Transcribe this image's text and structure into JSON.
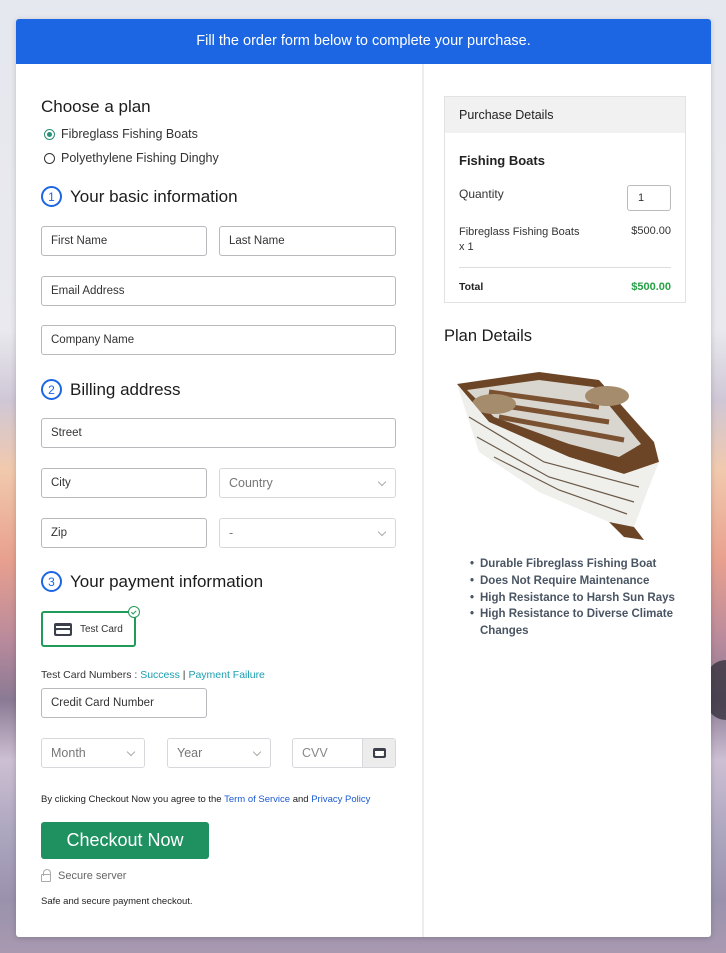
{
  "banner": {
    "text": "Fill the order form below to complete your purchase."
  },
  "plan": {
    "heading": "Choose a plan",
    "options": [
      {
        "label": "Fibreglass Fishing Boats",
        "selected": true
      },
      {
        "label": "Polyethylene Fishing Dinghy",
        "selected": false
      }
    ]
  },
  "basic_info": {
    "number": "1",
    "heading": "Your basic information",
    "first_name": "First Name",
    "last_name": "Last Name",
    "email": "Email Address",
    "company": "Company Name"
  },
  "billing": {
    "number": "2",
    "heading": "Billing address",
    "street": "Street",
    "city": "City",
    "country": "Country",
    "zip": "Zip",
    "state": "-"
  },
  "payment": {
    "number": "3",
    "heading": "Your payment information",
    "method_label": "Test Card",
    "test_numbers_label": "Test Card Numbers : ",
    "success_link": "Success",
    "separator": " | ",
    "failure_link": "Payment Failure",
    "card_number": "Credit Card Number",
    "month": "Month",
    "year": "Year",
    "cvv": "CVV"
  },
  "agreement": {
    "prefix": "By clicking Checkout Now you agree to the ",
    "terms": "Term of Service",
    "and": " and ",
    "privacy": "Privacy Policy"
  },
  "checkout": {
    "button": "Checkout Now",
    "secure_server": "Secure server",
    "safe_text": "Safe and secure payment checkout."
  },
  "purchase_details": {
    "heading": "Purchase Details",
    "product_title": "Fishing Boats",
    "quantity_label": "Quantity",
    "quantity_value": "1",
    "item_name": "Fibreglass Fishing Boats",
    "item_qty": "x 1",
    "item_price": "$500.00",
    "total_label": "Total",
    "total_value": "$500.00",
    "total_color": "#27a046"
  },
  "plan_details": {
    "heading": "Plan Details",
    "image_alt": "Wooden fishing boat",
    "features": [
      "Durable Fibreglass Fishing Boat",
      "Does Not Require Maintenance",
      "High Resistance to Harsh Sun Rays",
      "High Resistance to Diverse Climate Changes"
    ]
  },
  "colors": {
    "banner": "#1c66e4",
    "checkout": "#1f9160",
    "selected_method": "#229a5a",
    "link": "#1a9fb0"
  }
}
